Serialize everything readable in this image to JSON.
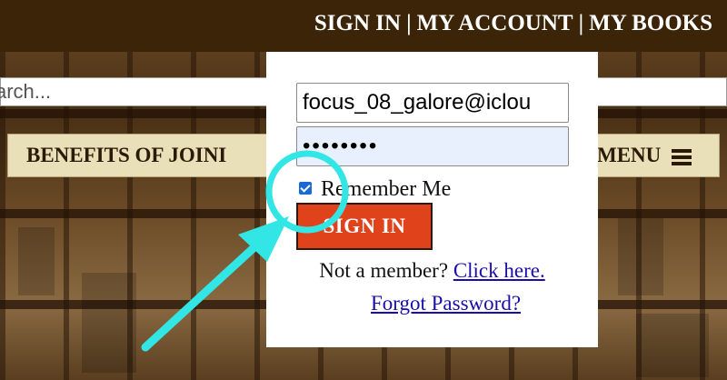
{
  "top_nav": {
    "sign_in": "SIGN IN",
    "separator": "|",
    "my_account": "MY ACCOUNT",
    "my_books": "MY BOOKS"
  },
  "search": {
    "text": "arch..."
  },
  "benefits": {
    "label": "BENEFITS OF JOINI"
  },
  "menu": {
    "label": "MENU",
    "icon": "hamburger-menu-icon"
  },
  "login_popup": {
    "email_value": "focus_08_galore@iclou",
    "password_value": "••••••••",
    "remember_label": "Remember Me",
    "remember_checked": true,
    "sign_in_button": "SIGN IN",
    "not_member_text": "Not a member?",
    "click_here_link": "Click here.",
    "forgot_password_link": "Forgot Password?"
  },
  "annotation": {
    "color": "#33e6e6",
    "shape": "circle-and-arrow"
  },
  "colors": {
    "top_bar": "#3b2408",
    "sign_in_button": "#e0431c",
    "nav_button_bg": "#e9dfb9",
    "link": "#1a0dab"
  }
}
